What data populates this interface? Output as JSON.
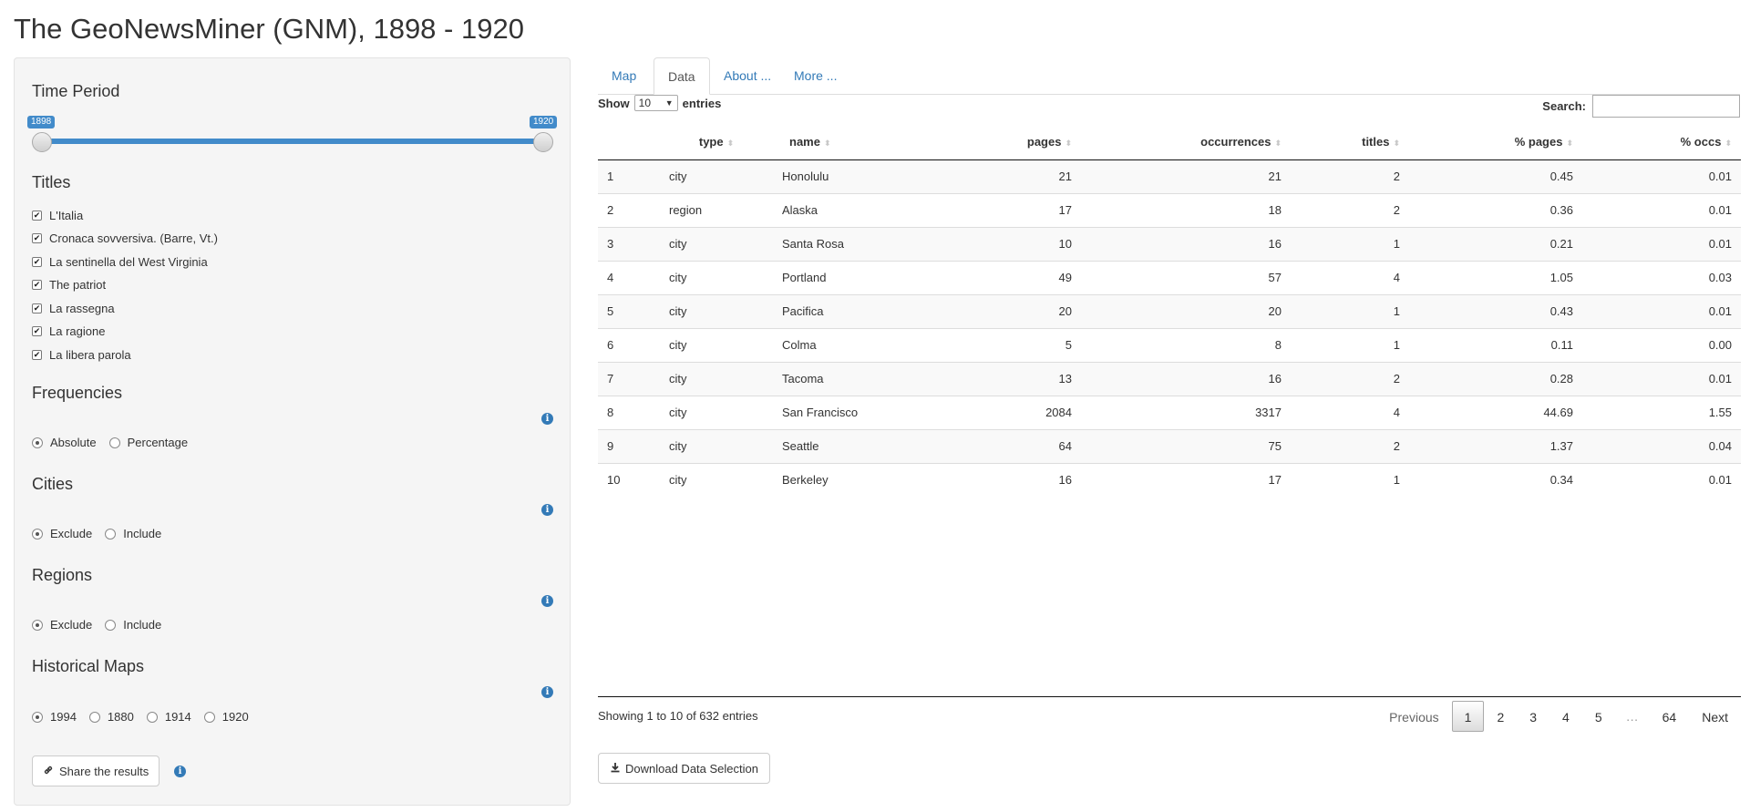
{
  "app": {
    "title": "The GeoNewsMiner (GNM), 1898 - 1920"
  },
  "sidebar": {
    "time_period": {
      "label": "Time Period",
      "min_label": "1898",
      "max_label": "1920",
      "range": [
        1898,
        1920
      ],
      "selected": [
        1898,
        1920
      ]
    },
    "titles": {
      "label": "Titles",
      "items": [
        {
          "label": "L'Italia",
          "checked": true
        },
        {
          "label": "Cronaca sovversiva. (Barre, Vt.)",
          "checked": true
        },
        {
          "label": "La sentinella del West Virginia",
          "checked": true
        },
        {
          "label": "The patriot",
          "checked": true
        },
        {
          "label": "La rassegna",
          "checked": true
        },
        {
          "label": "La ragione",
          "checked": true
        },
        {
          "label": "La libera parola",
          "checked": true
        }
      ]
    },
    "frequencies": {
      "label": "Frequencies",
      "options": [
        "Absolute",
        "Percentage"
      ],
      "selected": "Absolute"
    },
    "cities": {
      "label": "Cities",
      "options": [
        "Exclude",
        "Include"
      ],
      "selected": "Exclude"
    },
    "regions": {
      "label": "Regions",
      "options": [
        "Exclude",
        "Include"
      ],
      "selected": "Exclude"
    },
    "historical_maps": {
      "label": "Historical Maps",
      "options": [
        "1994",
        "1880",
        "1914",
        "1920"
      ],
      "selected": "1994"
    },
    "share_button": "Share the results",
    "info_glyph": "i"
  },
  "tabs": [
    {
      "label": "Map",
      "active": false
    },
    {
      "label": "Data",
      "active": true
    },
    {
      "label": "About ...",
      "active": false
    },
    {
      "label": "More ...",
      "active": false
    }
  ],
  "table": {
    "show_label": "Show",
    "entries_label": "entries",
    "length_value": "10",
    "search_label": "Search:",
    "search_value": "",
    "columns": [
      "",
      "type",
      "name",
      "pages",
      "occurrences",
      "titles",
      "% pages",
      "% occs"
    ],
    "rows": [
      [
        "1",
        "city",
        "Honolulu",
        "21",
        "21",
        "2",
        "0.45",
        "0.01"
      ],
      [
        "2",
        "region",
        "Alaska",
        "17",
        "18",
        "2",
        "0.36",
        "0.01"
      ],
      [
        "3",
        "city",
        "Santa Rosa",
        "10",
        "16",
        "1",
        "0.21",
        "0.01"
      ],
      [
        "4",
        "city",
        "Portland",
        "49",
        "57",
        "4",
        "1.05",
        "0.03"
      ],
      [
        "5",
        "city",
        "Pacifica",
        "20",
        "20",
        "1",
        "0.43",
        "0.01"
      ],
      [
        "6",
        "city",
        "Colma",
        "5",
        "8",
        "1",
        "0.11",
        "0.00"
      ],
      [
        "7",
        "city",
        "Tacoma",
        "13",
        "16",
        "2",
        "0.28",
        "0.01"
      ],
      [
        "8",
        "city",
        "San Francisco",
        "2084",
        "3317",
        "4",
        "44.69",
        "1.55"
      ],
      [
        "9",
        "city",
        "Seattle",
        "64",
        "75",
        "2",
        "1.37",
        "0.04"
      ],
      [
        "10",
        "city",
        "Berkeley",
        "16",
        "17",
        "1",
        "0.34",
        "0.01"
      ]
    ],
    "info": "Showing 1 to 10 of 632 entries",
    "pagination": {
      "previous": "Previous",
      "pages": [
        "1",
        "2",
        "3",
        "4",
        "5"
      ],
      "ellipsis": "…",
      "last": "64",
      "next": "Next",
      "current": "1"
    }
  },
  "download_button": "Download Data Selection",
  "colors": {
    "accent": "#428bca",
    "link": "#337ab7",
    "sidebar_bg": "#f5f5f5"
  },
  "icons": {
    "share": "link-icon",
    "download": "download-icon",
    "info": "info-icon",
    "sort": "sort-icon"
  }
}
